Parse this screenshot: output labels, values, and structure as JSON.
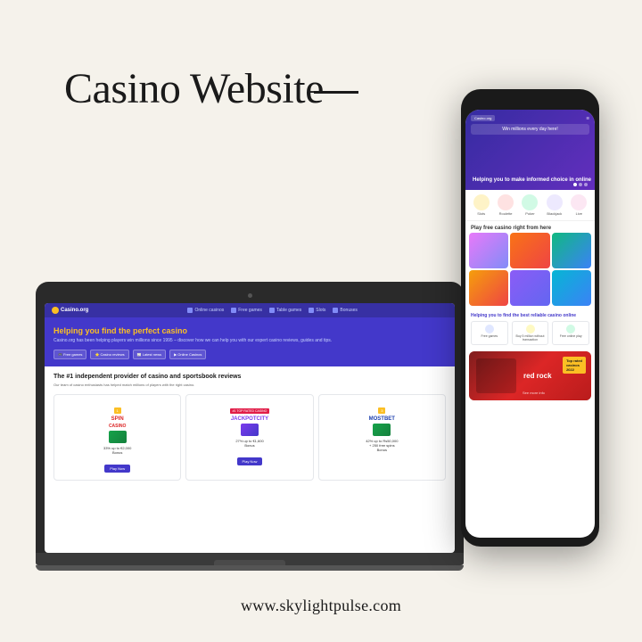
{
  "page": {
    "background_color": "#f5f2eb",
    "title": "Casino Website",
    "title_dash": "—",
    "footer_url": "www.skylightpulse.com"
  },
  "laptop": {
    "nav_items": [
      "Online casinos",
      "Free games",
      "Table games",
      "Slots",
      "Bonuses"
    ],
    "logo_text": "Casino.org",
    "hero_title": "Helping you find the perfect casino",
    "hero_subtitle": "Casino.org has been helping players win millions since 1995 – discover how we can help you with our expert casino reviews, guides and tips.",
    "hero_buttons": [
      "Free games",
      "Casino reviews",
      "Latest news",
      "Online Casinos"
    ],
    "body_title": "The #1 independent provider of casino and sportsbook reviews",
    "body_sub": "Our team of casino enthusiasts has helped match millions of players with the right casino.",
    "cards": [
      {
        "name": "SPIN",
        "badge": "1",
        "bonus": "33% up to €2,000\nBonus",
        "btn": "Play Now"
      },
      {
        "name": "JACKPOTCITY",
        "badge": "#1 TOP RATED CASINO",
        "bonus": "27% up to €1,600\nBonus",
        "btn": "Play Now"
      },
      {
        "name": "MOSTBET",
        "badge": "3",
        "bonus": "42% up to Rs50,000 + 250 free spins\nBonus",
        "btn": ""
      }
    ]
  },
  "phone": {
    "hero_text": "Helping you to make informed choice in online",
    "finding_text": "Helping you to find the best reliable casino online",
    "features": [
      "Free games",
      "Buy 5 million without\ntransaction",
      "Free online play"
    ],
    "red_rock_text": "red rock",
    "red_rock_badge": "Top rated\ncasinos\n2022"
  }
}
